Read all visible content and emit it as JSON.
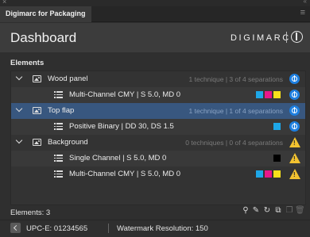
{
  "window": {
    "close_glyph": "×",
    "collapse_glyph": "«",
    "tab_title": "Digimarc for Packaging",
    "menu_glyph": "≡"
  },
  "header": {
    "title": "Dashboard",
    "brand": "DIGIMARC"
  },
  "elements": {
    "section_label": "Elements",
    "rows": [
      {
        "kind": "element",
        "name": "Wood panel",
        "info": "1 technique | 3 of 4 separations",
        "status": "ok",
        "selected": false
      },
      {
        "kind": "technique",
        "name": "Multi-Channel CMY | S 5.0, MD 0",
        "swatches": [
          "#1ea7e8",
          "#e8178a",
          "#f7e01b"
        ],
        "status": "ok"
      },
      {
        "kind": "element",
        "name": "Top flap",
        "info": "1 technique | 1 of 4 separations",
        "status": "ok",
        "selected": true
      },
      {
        "kind": "technique",
        "name": "Positive Binary | DD 30, DS 1.5",
        "swatches": [
          "#1ea7e8"
        ],
        "status": "ok"
      },
      {
        "kind": "element",
        "name": "Background",
        "info": "0 techniques | 0 of 4 separations",
        "status": "warning",
        "selected": false
      },
      {
        "kind": "technique",
        "name": "Single Channel | S 5.0, MD 0",
        "swatches": [
          "#000000"
        ],
        "status": "warning"
      },
      {
        "kind": "technique",
        "name": "Multi-Channel CMY | S 5.0, MD 0",
        "swatches": [
          "#1ea7e8",
          "#e8178a",
          "#f7e01b"
        ],
        "status": "warning"
      }
    ],
    "warning_glyph": "!"
  },
  "footer": {
    "elements_count": "Elements: 3",
    "tools": [
      "detect-icon",
      "pencil-icon",
      "refresh-icon",
      "duplicate-icon",
      "copy-icon",
      "trash-icon"
    ]
  },
  "status": {
    "upc": "UPC-E:  01234565",
    "watermark": "Watermark Resolution: 150"
  },
  "colors": {
    "accent_blue": "#1d7fe0",
    "selected_row": "#38577f",
    "warning": "#f2c230"
  }
}
